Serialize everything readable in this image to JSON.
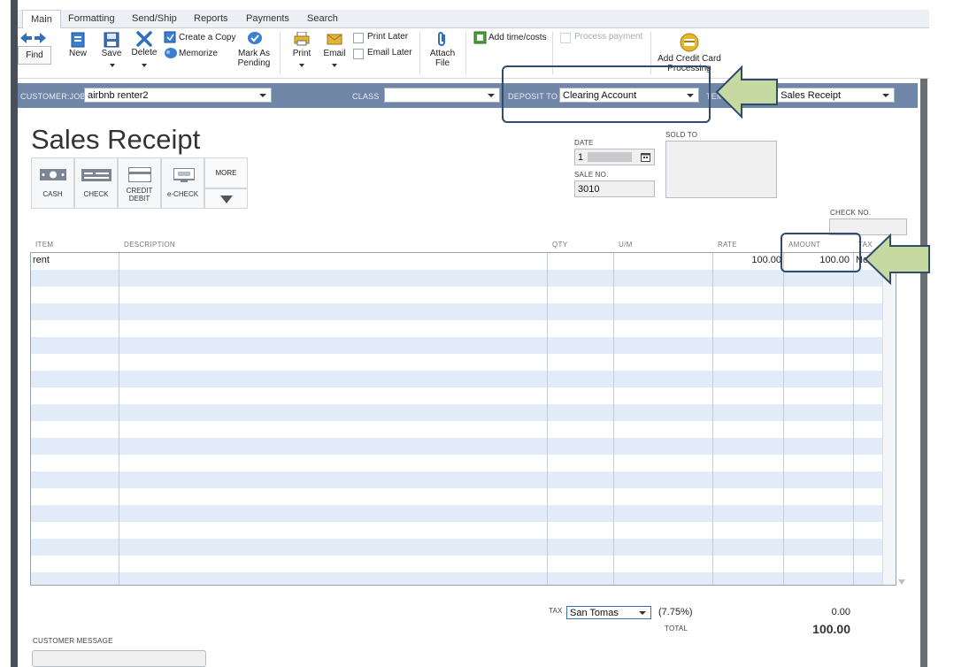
{
  "tabs": [
    "Main",
    "Formatting",
    "Send/Ship",
    "Reports",
    "Payments",
    "Search"
  ],
  "toolbar": {
    "find": "Find",
    "new": "New",
    "save": "Save",
    "delete": "Delete",
    "create_copy": "Create a Copy",
    "memorize": "Memorize",
    "mark_as_pending_1": "Mark As",
    "mark_as_pending_2": "Pending",
    "print": "Print",
    "email": "Email",
    "print_later": "Print Later",
    "email_later": "Email Later",
    "attach_file_1": "Attach",
    "attach_file_2": "File",
    "add_time_costs": "Add time/costs",
    "process_payment": "Process payment",
    "add_credit_card_1": "Add Credit Card",
    "add_credit_card_2": "Processing"
  },
  "header": {
    "customer_job_label": "CUSTOMER:JOB",
    "customer_job_value": "airbnb renter2",
    "class_label": "CLASS",
    "class_value": "",
    "deposit_to_label": "DEPOSIT TO",
    "deposit_to_value": "Clearing Account",
    "template_label": "TEM",
    "template_value": "m Sales Receipt"
  },
  "form": {
    "title": "Sales Receipt",
    "date_label": "DATE",
    "date_value": "1",
    "sale_no_label": "SALE NO.",
    "sale_no_value": "3010",
    "sold_to_label": "SOLD TO",
    "check_no_label": "CHECK NO.",
    "payment_methods": [
      "CASH",
      "CHECK",
      "CREDIT DEBIT",
      "e-CHECK"
    ],
    "credit_1": "CREDIT",
    "credit_2": "DEBIT",
    "more": "MORE"
  },
  "table": {
    "columns": [
      "ITEM",
      "DESCRIPTION",
      "QTY",
      "U/M",
      "RATE",
      "AMOUNT",
      "TAX"
    ],
    "rows": [
      {
        "item": "rent",
        "description": "",
        "qty": "",
        "um": "",
        "rate": "100.00",
        "amount": "100.00",
        "tax": "No"
      }
    ]
  },
  "footer": {
    "tax_label": "TAX",
    "tax_value": "San Tomas",
    "tax_rate": "(7.75%)",
    "tax_amount": "0.00",
    "total_label": "TOTAL",
    "total_value": "100.00",
    "customer_message_label": "CUSTOMER MESSAGE"
  },
  "colors": {
    "band": "#6f86a6",
    "row_alt": "#e2ecf8",
    "callout_border": "#2f4b6e",
    "arrow_fill": "#c5d9a0",
    "arrow_stroke": "#2f4b6e"
  }
}
